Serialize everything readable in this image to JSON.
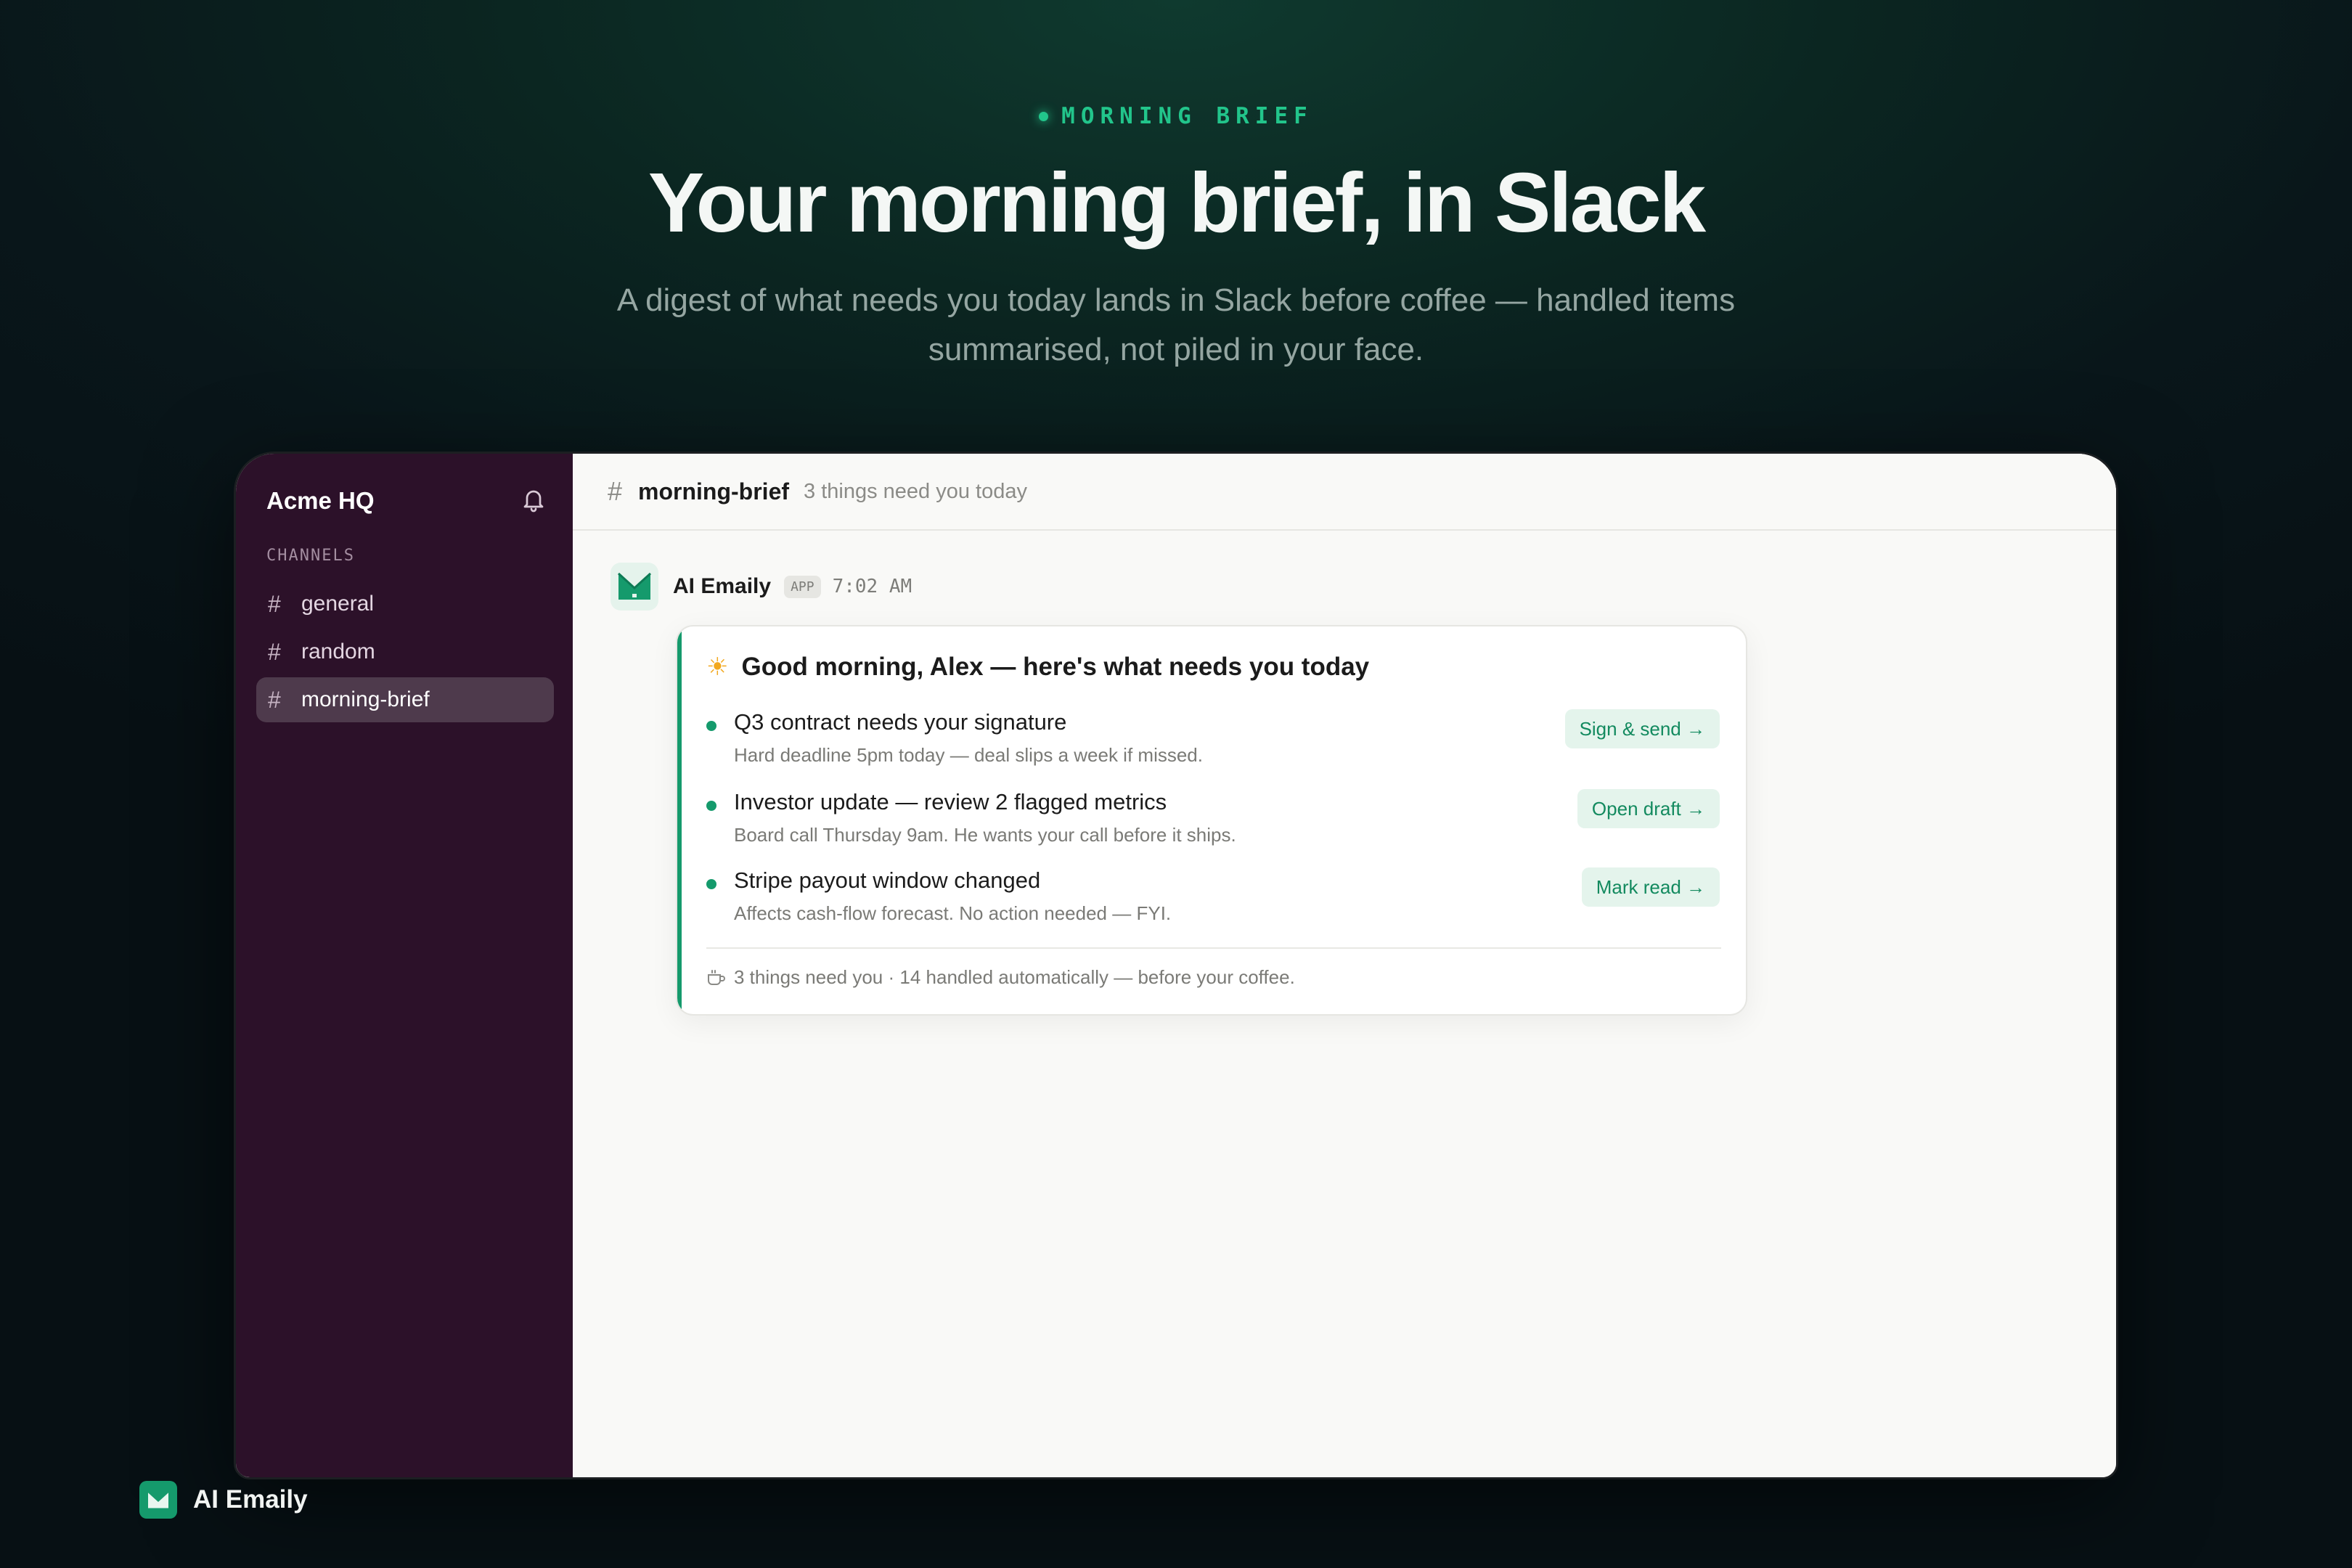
{
  "hero": {
    "eyebrow": "MORNING BRIEF",
    "headline": "Your morning brief, in Slack",
    "subhead": "A digest of what needs you today lands in Slack before coffee — handled items summarised, not piled in your face."
  },
  "sidebar": {
    "workspace": "Acme HQ",
    "bell_icon": "bell-icon",
    "channels_header": "CHANNELS",
    "channels": [
      {
        "label": "general",
        "active": false
      },
      {
        "label": "random",
        "active": false
      },
      {
        "label": "morning-brief",
        "active": true
      }
    ]
  },
  "channel_header": {
    "name": "morning-brief",
    "topic": "3 things need you today"
  },
  "message": {
    "sender": "AI Emaily",
    "badge": "APP",
    "time": "7:02 AM",
    "card": {
      "title": "Good morning, Alex — here's what needs you today",
      "items": [
        {
          "title": "Q3 contract needs your signature",
          "subtitle": "Hard deadline 5pm today — deal slips a week if missed.",
          "action": "Sign & send →"
        },
        {
          "title": "Investor update — review 2 flagged metrics",
          "subtitle": "Board call Thursday 9am. He wants your call before it ships.",
          "action": "Open draft →"
        },
        {
          "title": "Stripe payout window changed",
          "subtitle": "Affects cash-flow forecast. No action needed — FYI.",
          "action": "Mark read →"
        }
      ],
      "footer": "3 things need you · 14 handled automatically — before your coffee."
    }
  },
  "brand": {
    "name": "AI Emaily"
  },
  "colors": {
    "accent": "#159a6c",
    "sidebar": "#2c1129",
    "eyebrow": "#22c58b"
  }
}
